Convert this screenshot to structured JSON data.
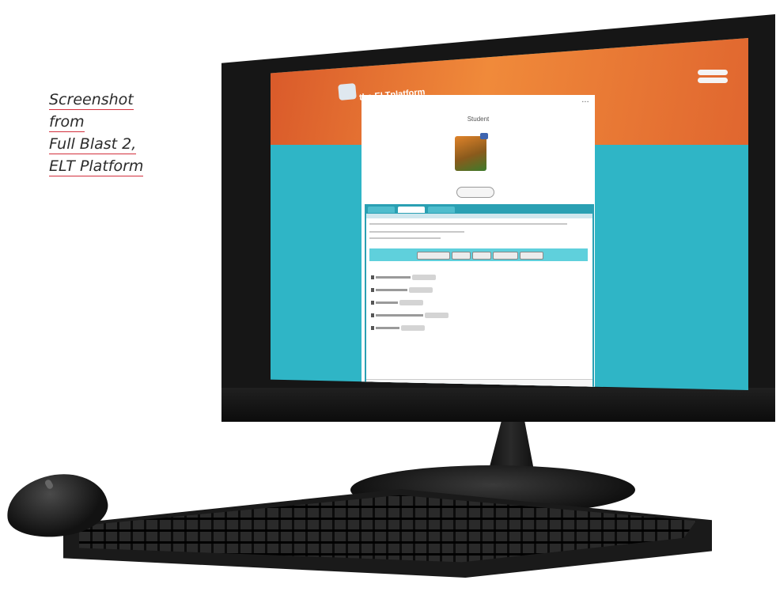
{
  "caption": {
    "lines": [
      "Screenshot",
      "from",
      "Full Blast 2,",
      "ELT Platform"
    ]
  },
  "screen": {
    "brand": "the ELTplatform",
    "panel_title": "Student",
    "colors": {
      "accent_cyan": "#2fb5c6",
      "header_orange": "#e86f31",
      "caption_underline": "#d3303d"
    }
  }
}
